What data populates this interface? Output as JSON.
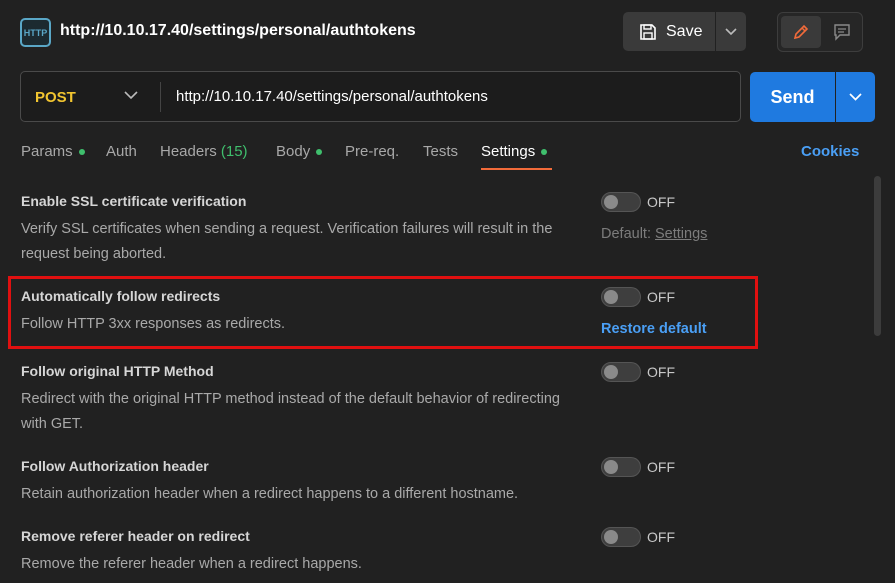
{
  "header": {
    "icon_text": "HTTP",
    "title": "http://10.10.17.40/settings/personal/authtokens",
    "save_label": "Save"
  },
  "request": {
    "method": "POST",
    "url": "http://10.10.17.40/settings/personal/authtokens",
    "send_label": "Send"
  },
  "tabs": {
    "params": "Params",
    "auth": "Auth",
    "headers": "Headers",
    "headers_count": "(15)",
    "body": "Body",
    "prereq": "Pre-req.",
    "tests": "Tests",
    "settings": "Settings",
    "cookies": "Cookies"
  },
  "settings": [
    {
      "title": "Enable SSL certificate verification",
      "description": "Verify SSL certificates when sending a request. Verification failures will result in the request being aborted.",
      "state": "OFF",
      "default_prefix": "Default:",
      "default_link": "Settings"
    },
    {
      "title": "Automatically follow redirects",
      "description": "Follow HTTP 3xx responses as redirects.",
      "state": "OFF",
      "restore_label": "Restore default"
    },
    {
      "title": "Follow original HTTP Method",
      "description": "Redirect with the original HTTP method instead of the default behavior of redirecting with GET.",
      "state": "OFF"
    },
    {
      "title": "Follow Authorization header",
      "description": "Retain authorization header when a redirect happens to a different hostname.",
      "state": "OFF"
    },
    {
      "title": "Remove referer header on redirect",
      "description": "Remove the referer header when a redirect happens.",
      "state": "OFF"
    }
  ],
  "colors": {
    "accent_blue": "#1f7ae0",
    "method_yellow": "#f2c530",
    "active_tab_underline": "#f26b3a",
    "dot_green": "#3fbf6d",
    "highlight_red": "#e01010"
  }
}
